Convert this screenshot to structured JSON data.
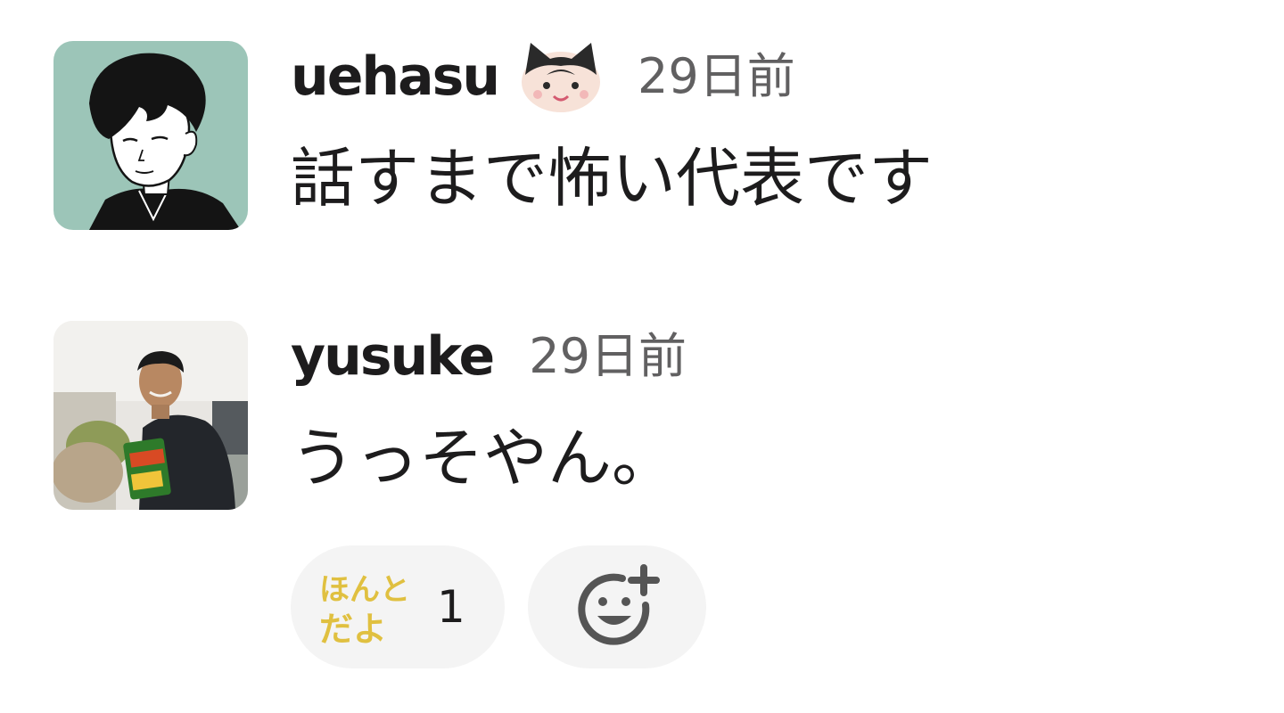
{
  "messages": [
    {
      "username": "uehasu",
      "status_emoji": "cat-face-emoji",
      "timestamp": "29日前",
      "text": "話すまで怖い代表です",
      "avatar": "illustrated-portrait-avatar"
    },
    {
      "username": "yusuke",
      "timestamp": "29日前",
      "text": "うっそやん。",
      "avatar": "photo-avatar"
    }
  ],
  "reactions": [
    {
      "emoji_text": "ほんとだよ",
      "emoji_lines": [
        "ほんと",
        "だよ"
      ],
      "count": "1",
      "color": "#e0c040"
    }
  ],
  "add_reaction_icon": "add-emoji-icon",
  "colors": {
    "text": "#1d1c1d",
    "timestamp": "#616061",
    "pill_background": "#f4f4f4",
    "avatar1_background": "#9cc5b8"
  }
}
